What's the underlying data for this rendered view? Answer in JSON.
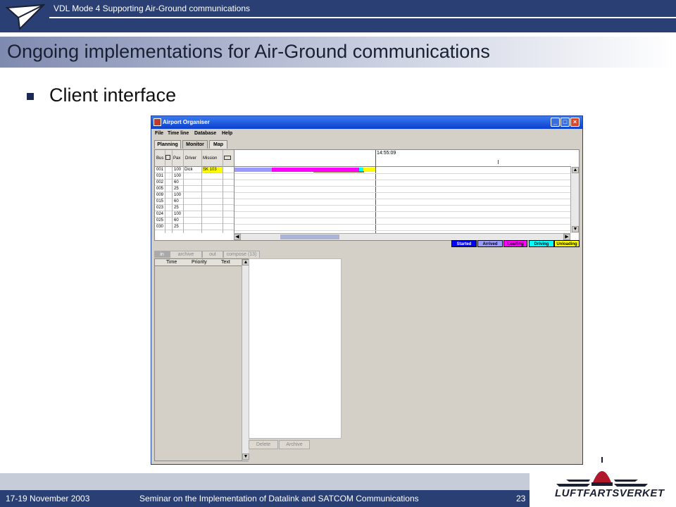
{
  "slide": {
    "header_title": "VDL Mode 4 Supporting Air-Ground communications",
    "title": "Ongoing implementations for Air-Ground communications",
    "bullet": "Client interface",
    "footer": {
      "date": "17-19 November 2003",
      "seminar": "Seminar on the Implementation of Datalink and SATCOM Communications",
      "page": "23",
      "logo_text": "LUFTFARTSVERKET"
    }
  },
  "app": {
    "window_title": "Airport Organiser",
    "menu": [
      "File",
      "Time line",
      "Database",
      "Help"
    ],
    "tabs": [
      "Planning",
      "Monitor",
      "Map"
    ],
    "active_tab": "Monitor",
    "table": {
      "headers": [
        "Bus",
        "Pax",
        "Driver",
        "Mission"
      ],
      "rows": [
        {
          "bus": "001",
          "pax": "100",
          "driver": "Dick",
          "mission": "SK 103"
        },
        {
          "bus": "031",
          "pax": "100",
          "driver": "",
          "mission": ""
        },
        {
          "bus": "002",
          "pax": "60",
          "driver": "",
          "mission": ""
        },
        {
          "bus": "005",
          "pax": "25",
          "driver": "",
          "mission": ""
        },
        {
          "bus": "009",
          "pax": "100",
          "driver": "",
          "mission": ""
        },
        {
          "bus": "015",
          "pax": "60",
          "driver": "",
          "mission": ""
        },
        {
          "bus": "023",
          "pax": "25",
          "driver": "",
          "mission": ""
        },
        {
          "bus": "024",
          "pax": "100",
          "driver": "",
          "mission": ""
        },
        {
          "bus": "025",
          "pax": "60",
          "driver": "",
          "mission": ""
        },
        {
          "bus": "030",
          "pax": "25",
          "driver": "",
          "mission": ""
        }
      ]
    },
    "current_time": "14:55:09",
    "legend": [
      {
        "label": "Started",
        "color": "#0000ff",
        "text_color": "#ffffff"
      },
      {
        "label": "Arrived",
        "color": "#9999ff",
        "text_color": "#000000"
      },
      {
        "label": "Loading",
        "color": "#ff00ff",
        "text_color": "#000000"
      },
      {
        "label": "Driving",
        "color": "#00ffff",
        "text_color": "#000000"
      },
      {
        "label": "Unloading",
        "color": "#ffff00",
        "text_color": "#000000"
      }
    ],
    "messages": {
      "tabs": [
        "in",
        "archive",
        "out",
        "compose (13)"
      ],
      "active_tab": "in",
      "headers": [
        "Time",
        "Priority",
        "Text"
      ],
      "buttons": [
        "Delete",
        "Archive"
      ]
    }
  }
}
